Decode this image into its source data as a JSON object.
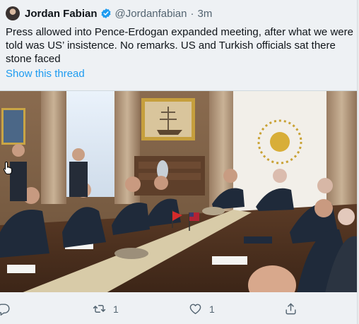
{
  "tweet": {
    "author_name": "Jordan Fabian",
    "handle": "@Jordanfabian",
    "separator": "·",
    "time": "3m",
    "text": "Press allowed into Pence-Erdogan expanded meeting, after what we were told was US’ insistence. No remarks. US and Turkish officials sat there stone faced",
    "show_thread": "Show this thread"
  },
  "icons": {
    "verified": "verified-badge-icon",
    "reply": "reply-icon",
    "retweet": "retweet-icon",
    "like": "like-icon",
    "share": "share-icon"
  },
  "actions": {
    "reply_count": "",
    "retweet_count": "1",
    "like_count": "1"
  },
  "colors": {
    "link_blue": "#1d9bf0",
    "secondary_text": "#536471",
    "verified_blue": "#1d9bf0"
  }
}
